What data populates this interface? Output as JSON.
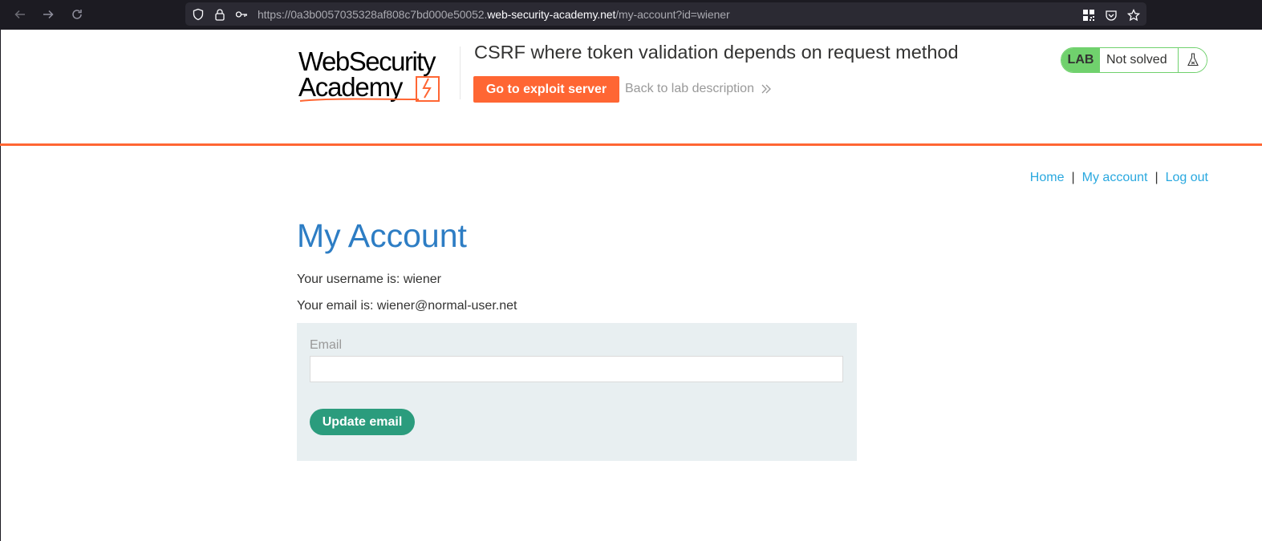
{
  "browser": {
    "url_prefix": "https://0a3b0057035328af808c7bd000e50052.",
    "url_domain": "web-security-academy.net",
    "url_path": "/my-account?id=wiener",
    "icons": [
      "back-icon",
      "forward-icon",
      "reload-icon",
      "shield-icon",
      "lock-icon",
      "key-icon",
      "qr-code-icon",
      "pocket-icon",
      "bookmark-star-icon"
    ]
  },
  "header": {
    "logo_line1": "WebSecurity",
    "logo_line2": "Academy",
    "lab_title": "CSRF where token validation depends on request method",
    "exploit_button": "Go to exploit server",
    "back_link": "Back to lab description",
    "lab_badge_label": "LAB",
    "lab_status": "Not solved"
  },
  "nav": {
    "home": "Home",
    "my_account": "My account",
    "log_out": "Log out",
    "separator": "|"
  },
  "main": {
    "title": "My Account",
    "username_label": "Your username is: ",
    "username": "wiener",
    "email_label": "Your email is: ",
    "email": "wiener@normal-user.net",
    "form": {
      "email_field_label": "Email",
      "email_value": "",
      "submit_label": "Update email"
    }
  },
  "colors": {
    "accent_orange": "#ff6633",
    "lab_green": "#70d16d",
    "link_blue": "#29a8df",
    "title_blue": "#2d7dc4",
    "button_green": "#2b9c7d",
    "form_bg": "#e8eff1"
  }
}
